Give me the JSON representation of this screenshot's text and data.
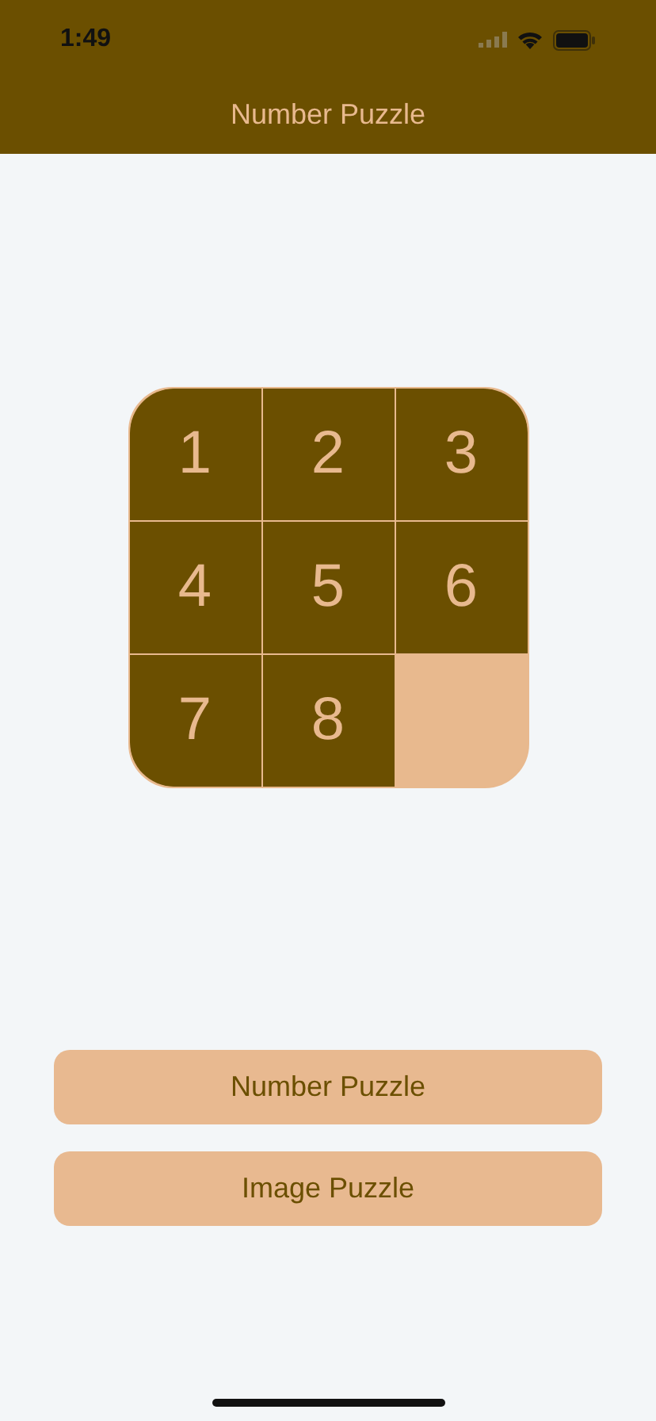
{
  "status_bar": {
    "time": "1:49"
  },
  "header": {
    "title": "Number Puzzle"
  },
  "board": {
    "tiles": [
      {
        "kind": "number",
        "label": "1"
      },
      {
        "kind": "number",
        "label": "2"
      },
      {
        "kind": "number",
        "label": "3"
      },
      {
        "kind": "number",
        "label": "4"
      },
      {
        "kind": "number",
        "label": "5"
      },
      {
        "kind": "number",
        "label": "6"
      },
      {
        "kind": "number",
        "label": "7"
      },
      {
        "kind": "number",
        "label": "8"
      },
      {
        "kind": "empty"
      }
    ]
  },
  "buttons": [
    "Number Puzzle",
    "Image Puzzle"
  ]
}
